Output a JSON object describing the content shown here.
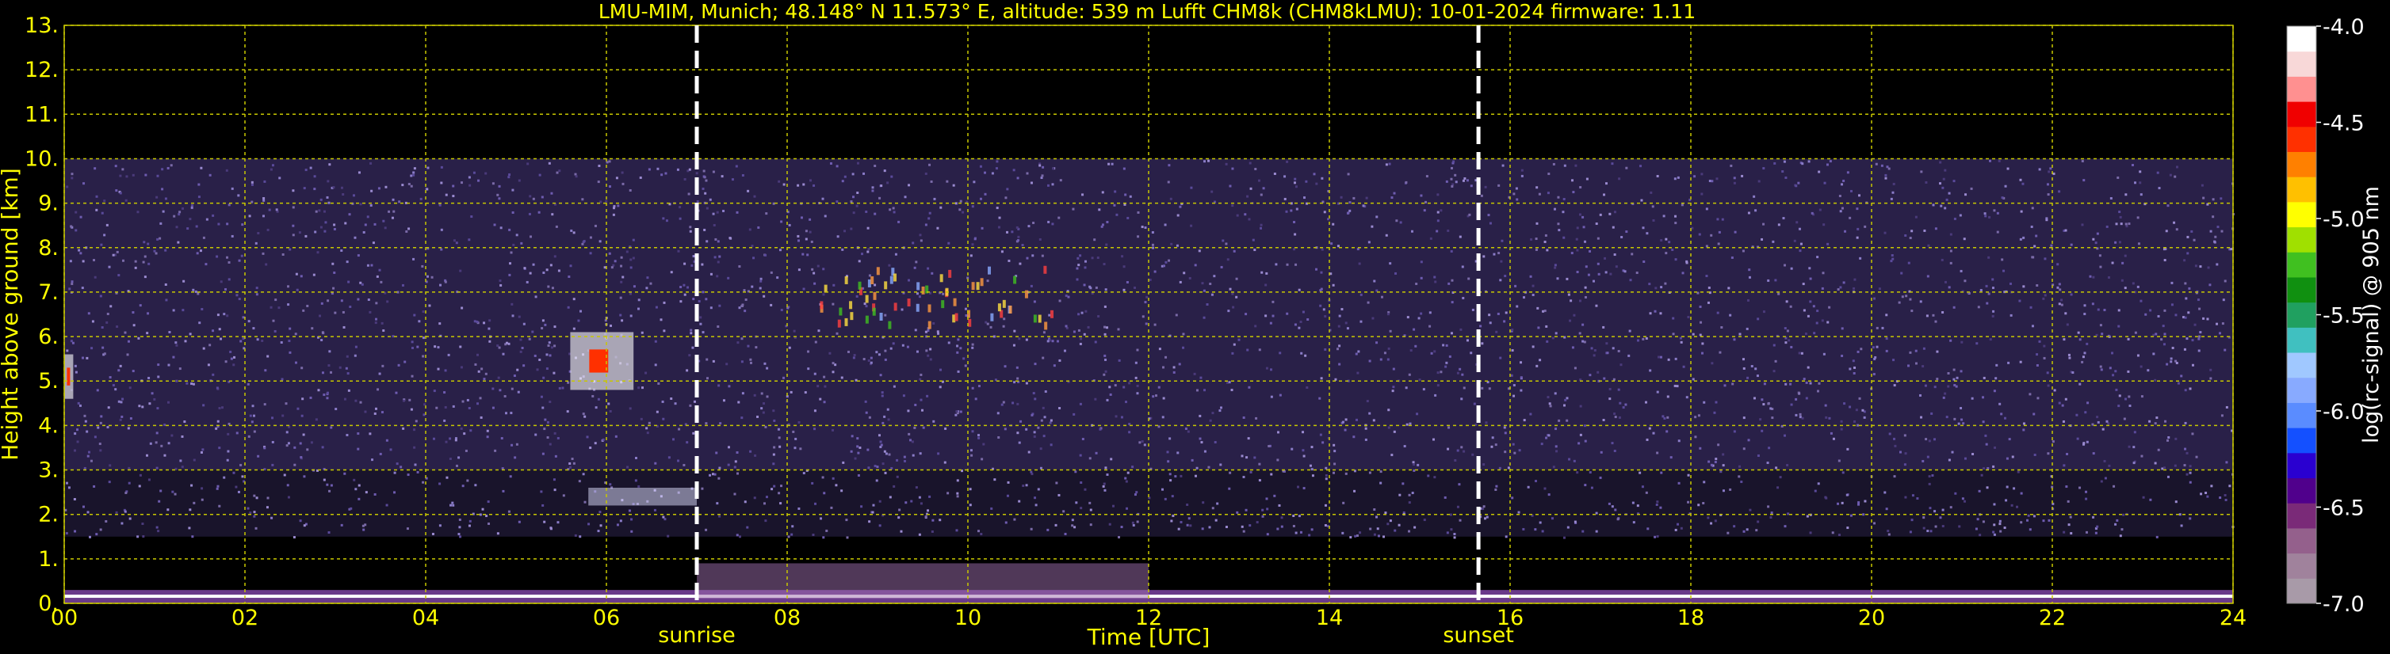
{
  "title": "LMU-MIM, Munich; 48.148° N 11.573° E, altitude: 539 m    Lufft CHM8k (CHM8kLMU): 10-01-2024    firmware: 1.11",
  "chart_data": {
    "type": "heatmap",
    "xlabel": "Time [UTC]",
    "ylabel": "Height above ground [km]",
    "xlim": [
      0,
      24
    ],
    "ylim": [
      0,
      13
    ],
    "x_ticks": [
      "00",
      "02",
      "04",
      "06",
      "08",
      "10",
      "12",
      "14",
      "16",
      "18",
      "20",
      "22",
      "24"
    ],
    "y_ticks": [
      "0.",
      "1.",
      "2.",
      "3.",
      "4.",
      "5.",
      "6.",
      "7.",
      "8.",
      "9.",
      "10.",
      "11.",
      "12.",
      "13."
    ],
    "grid": true,
    "data_top_km": 10.0,
    "markers": [
      {
        "label": "sunrise",
        "x": 7.0
      },
      {
        "label": "sunset",
        "x": 15.65
      }
    ],
    "features": [
      {
        "name": "surface layer",
        "x": [
          0,
          24
        ],
        "y": [
          0.0,
          0.3
        ]
      },
      {
        "name": "boundary layer aerosol",
        "x": [
          7.0,
          12.0
        ],
        "y": [
          0.1,
          0.9
        ]
      },
      {
        "name": "low cloud",
        "x": [
          5.8,
          7.0
        ],
        "y": [
          2.2,
          2.6
        ]
      },
      {
        "name": "mid cloud",
        "x": [
          5.6,
          6.3
        ],
        "y": [
          4.8,
          6.1
        ]
      },
      {
        "name": "mid cloud",
        "x": [
          0.0,
          0.1
        ],
        "y": [
          4.6,
          5.6
        ]
      },
      {
        "name": "cirrus",
        "x": [
          8.3,
          11.0
        ],
        "y": [
          6.3,
          7.6
        ]
      }
    ],
    "colorbar": {
      "label": "log(rc-signal) @ 905 nm",
      "range": [
        -7.0,
        -4.0
      ],
      "ticks": [
        "-4.0",
        "-4.5",
        "-5.0",
        "-5.5",
        "-6.0",
        "-6.5",
        "-7.0"
      ],
      "colors": [
        "#a89aa8",
        "#a0829c",
        "#94608c",
        "#7a2a78",
        "#50008c",
        "#2a00d0",
        "#1450ff",
        "#5a8cff",
        "#88aaff",
        "#a0c8ff",
        "#40c0c0",
        "#20a060",
        "#109010",
        "#40c020",
        "#a0e000",
        "#ffff00",
        "#ffc000",
        "#ff8000",
        "#ff3000",
        "#f00000",
        "#ff9090",
        "#f8d8d8",
        "#ffffff"
      ]
    }
  }
}
